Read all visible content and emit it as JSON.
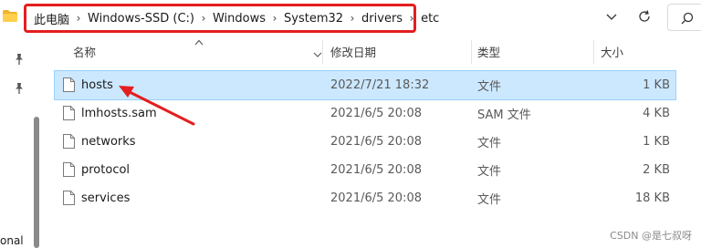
{
  "address": {
    "crumbs": [
      "此电脑",
      "Windows-SSD (C:)",
      "Windows",
      "System32",
      "drivers",
      "etc"
    ]
  },
  "columns": {
    "name": "名称",
    "date": "修改日期",
    "type": "类型",
    "size": "大小"
  },
  "files": [
    {
      "name": "hosts",
      "date": "2022/7/21 18:32",
      "type": "文件",
      "size": "1 KB",
      "selected": true
    },
    {
      "name": "lmhosts.sam",
      "date": "2021/6/5 20:08",
      "type": "SAM 文件",
      "size": "4 KB",
      "selected": false
    },
    {
      "name": "networks",
      "date": "2021/6/5 20:08",
      "type": "文件",
      "size": "1 KB",
      "selected": false
    },
    {
      "name": "protocol",
      "date": "2021/6/5 20:08",
      "type": "文件",
      "size": "2 KB",
      "selected": false
    },
    {
      "name": "services",
      "date": "2021/6/5 20:08",
      "type": "文件",
      "size": "18 KB",
      "selected": false
    }
  ],
  "nav": {
    "cut_label": "onal"
  },
  "watermark": "CSDN @是七叔呀",
  "colors": {
    "annotation": "#e41e1e",
    "selection": "#cce8ff",
    "folder": "#f0b429"
  },
  "icons": [
    "folder-icon",
    "chevron-right-icon",
    "chevron-down-icon",
    "refresh-icon",
    "search-icon",
    "pin-icon",
    "file-icon",
    "sort-up-icon"
  ]
}
